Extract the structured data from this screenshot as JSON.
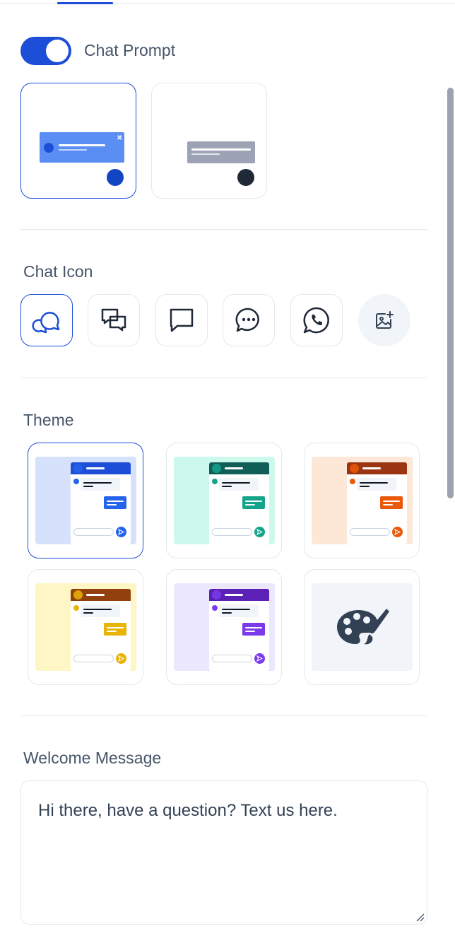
{
  "chat_prompt": {
    "label": "Chat Prompt",
    "enabled": true,
    "styles": [
      {
        "name": "banner-with-close",
        "selected": true
      },
      {
        "name": "banner-minimal",
        "selected": false
      }
    ]
  },
  "chat_icon": {
    "label": "Chat Icon",
    "options": [
      "chat-bubbles-icon",
      "chat-boxes-icon",
      "chat-square-icon",
      "chat-dots-icon",
      "whatsapp-icon",
      "upload-image-icon"
    ],
    "selected_index": 0
  },
  "theme": {
    "label": "Theme",
    "options": [
      {
        "name": "blue",
        "bg": "#d6e2fb",
        "primary": "#1d4ed8",
        "accent": "#2563eb",
        "selected": true
      },
      {
        "name": "teal",
        "bg": "#cdf8ec",
        "primary": "#115e59",
        "accent": "#14a38b",
        "selected": false
      },
      {
        "name": "orange",
        "bg": "#fde7d7",
        "primary": "#9a3412",
        "accent": "#ea580c",
        "selected": false
      },
      {
        "name": "amber",
        "bg": "#fff6c6",
        "primary": "#92400e",
        "accent": "#eab308",
        "selected": false
      },
      {
        "name": "purple",
        "bg": "#ebe8fd",
        "primary": "#5b21b6",
        "accent": "#7c3aed",
        "selected": false
      },
      {
        "name": "custom",
        "icon": "palette-icon",
        "selected": false
      }
    ]
  },
  "welcome_message": {
    "label": "Welcome Message",
    "value": "Hi there, have a question? Text us here."
  },
  "colors": {
    "accent": "#1d4ed8",
    "border": "#e2e8f0",
    "text": "#475569"
  }
}
